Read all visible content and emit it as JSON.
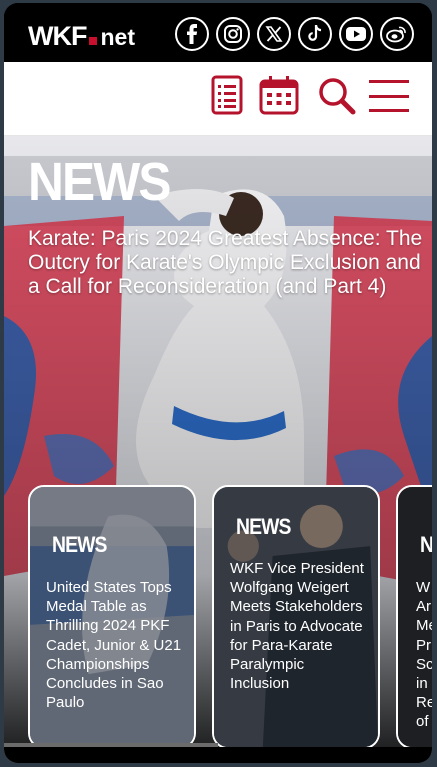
{
  "header": {
    "logo_main": "WKF",
    "logo_suffix": "net",
    "socials": [
      "facebook-icon",
      "instagram-icon",
      "x-icon",
      "tiktok-icon",
      "youtube-icon",
      "weibo-icon"
    ]
  },
  "nav": {
    "icons": [
      "list-icon",
      "calendar-icon",
      "search-icon",
      "menu-icon"
    ],
    "accent_color": "#b5122b"
  },
  "hero": {
    "label": "NEWS",
    "title": "Karate: Paris 2024 Greatest Absence: The Outcry for Karate's Olympic Exclusion and a Call for Reconsideration (and Part 4)"
  },
  "cards": [
    {
      "label": "NEWS",
      "title": "United States Tops Medal Table as Thrilling 2024 PKF Cadet, Junior & U21 Championships Concludes in Sao Paulo"
    },
    {
      "label": "NEWS",
      "title": "WKF Vice President Wolfgang Weigert Meets Stakeholders in Paris to Advocate for Para-Karate Paralympic Inclusion"
    },
    {
      "label": "N",
      "title": "W Ar Me Pr Sc in Re of"
    }
  ]
}
